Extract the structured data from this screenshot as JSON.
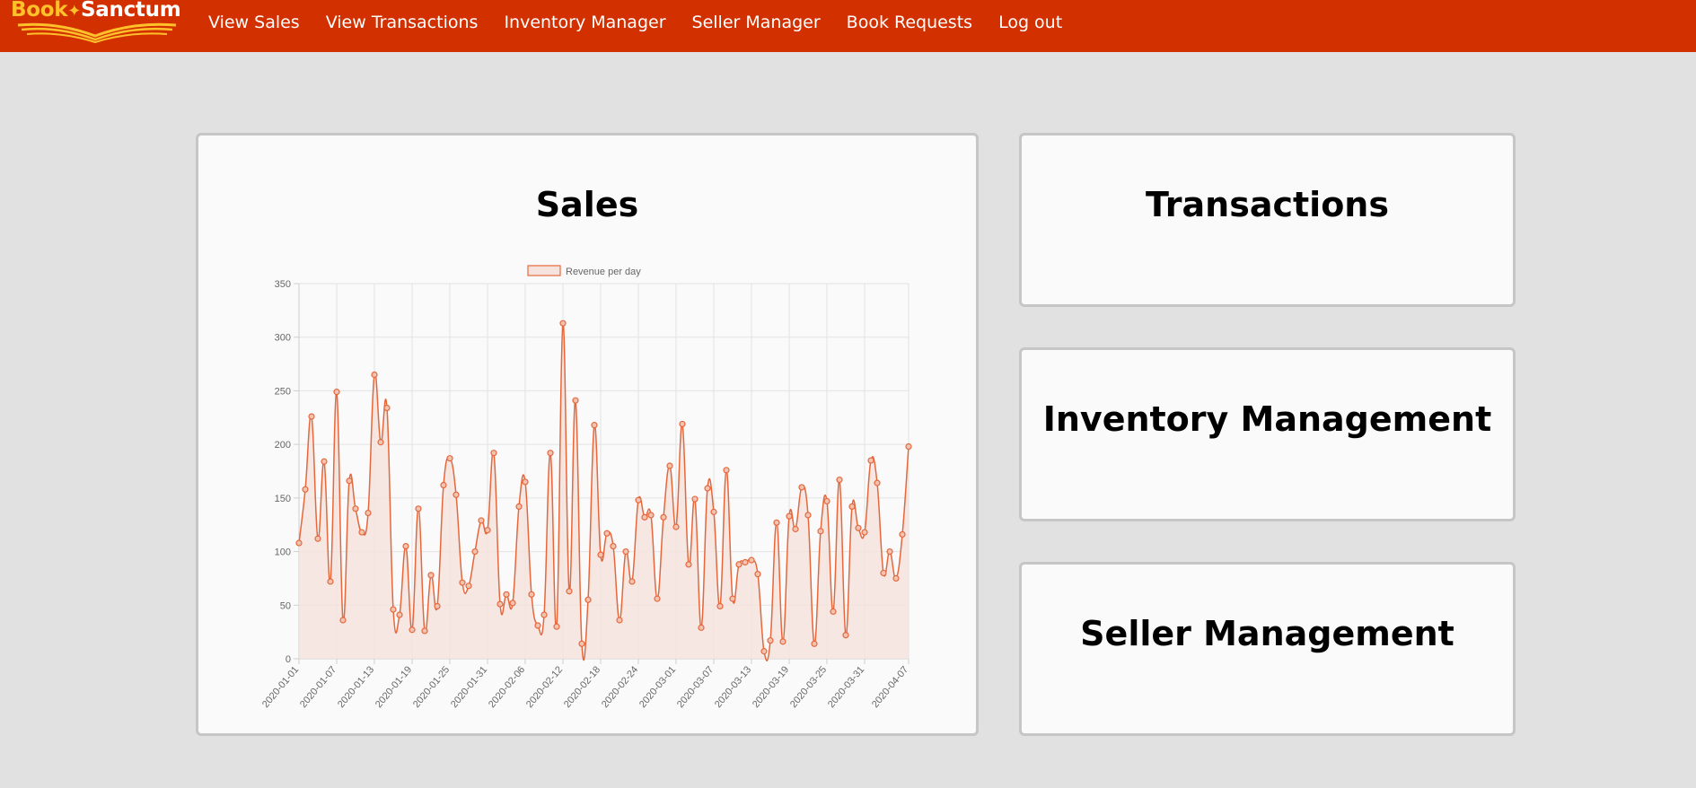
{
  "nav": {
    "logo": {
      "part1": "Book",
      "part2": "Sanctum"
    },
    "links": [
      {
        "label": "View Sales"
      },
      {
        "label": "View Transactions"
      },
      {
        "label": "Inventory Manager"
      },
      {
        "label": "Seller Manager"
      },
      {
        "label": "Book Requests"
      },
      {
        "label": "Log out"
      }
    ]
  },
  "colors": {
    "navbar": "#d33000",
    "logo_accent": "#ffc12a",
    "line": "#e5683d",
    "fill": "#f6e3dd",
    "background": "#e1e1e1",
    "card": "#fafafa"
  },
  "cards": {
    "sales": {
      "title": "Sales"
    },
    "transactions": {
      "title": "Transactions"
    },
    "inventory": {
      "title": "Inventory Management"
    },
    "seller": {
      "title": "Seller Management"
    }
  },
  "chart_data": {
    "type": "line",
    "legend": "Revenue per day",
    "legend_position": "top-center",
    "fill": true,
    "grid": true,
    "ylim": [
      0,
      350
    ],
    "yticks": [
      0,
      50,
      100,
      150,
      200,
      250,
      300,
      350
    ],
    "x_start": "2020-01-01",
    "x_end": "2020-04-07",
    "x_tick_labels": [
      "2020-01-01",
      "2020-01-07",
      "2020-01-13",
      "2020-01-19",
      "2020-01-25",
      "2020-01-31",
      "2020-02-06",
      "2020-02-12",
      "2020-02-18",
      "2020-02-24",
      "2020-03-01",
      "2020-03-07",
      "2020-03-13",
      "2020-03-19",
      "2020-03-25",
      "2020-03-31",
      "2020-04-07"
    ],
    "values": [
      108,
      158,
      226,
      112,
      184,
      72,
      249,
      36,
      166,
      140,
      118,
      136,
      265,
      202,
      234,
      46,
      41,
      105,
      27,
      140,
      26,
      78,
      49,
      162,
      187,
      153,
      71,
      68,
      100,
      129,
      120,
      192,
      51,
      60,
      52,
      142,
      165,
      60,
      31,
      41,
      192,
      30,
      313,
      63,
      241,
      14,
      55,
      218,
      97,
      117,
      105,
      36,
      100,
      72,
      148,
      132,
      134,
      56,
      132,
      180,
      123,
      219,
      88,
      149,
      29,
      159,
      137,
      49,
      176,
      56,
      88,
      90,
      92,
      79,
      7,
      17,
      127,
      16,
      133,
      121,
      160,
      134,
      14,
      119,
      147,
      44,
      167,
      22,
      142,
      122,
      118,
      185,
      164,
      80,
      100,
      75,
      116,
      198
    ]
  }
}
